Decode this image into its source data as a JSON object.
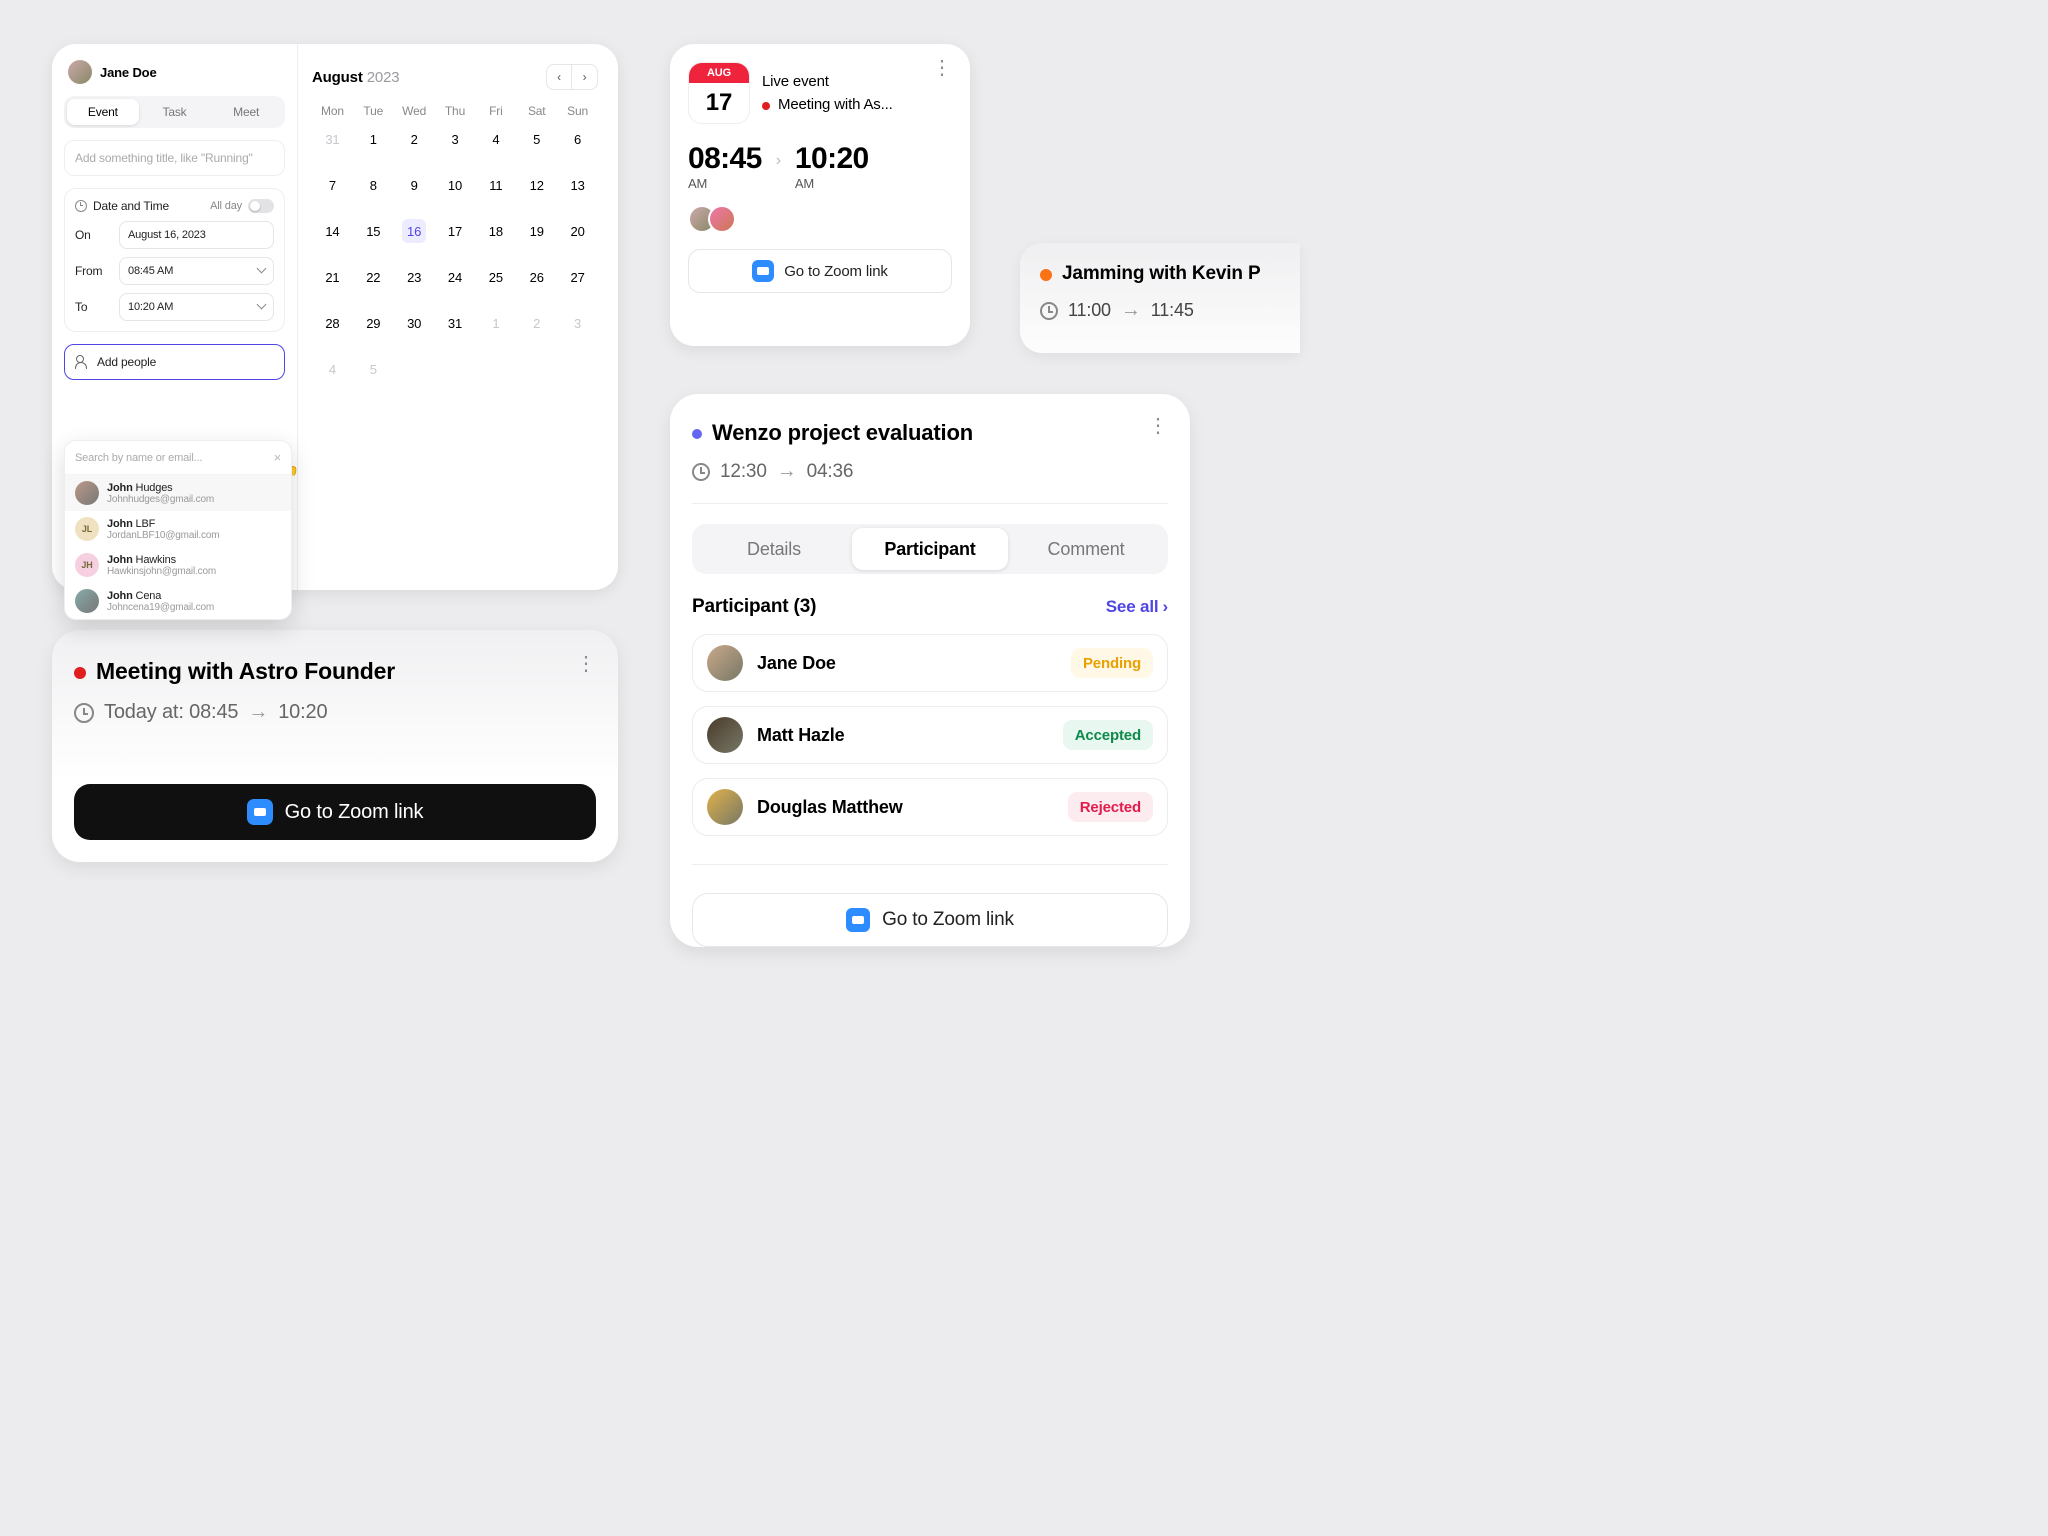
{
  "create": {
    "user_name": "Jane Doe",
    "tabs": {
      "event": "Event",
      "task": "Task",
      "meet": "Meet",
      "active": "event"
    },
    "title_placeholder": "Add something title, like \"Running\"",
    "dt": {
      "label": "Date and Time",
      "allday_label": "All day",
      "on_label": "On",
      "on_value": "August 16, 2023",
      "from_label": "From",
      "from_value": "08:45 AM",
      "to_label": "To",
      "to_value": "10:20 AM"
    },
    "add_people_label": "Add people",
    "people_search_placeholder": "Search by name or email...",
    "people": [
      {
        "first": "John",
        "last": "Hudges",
        "email": "Johnhudges@gmail.com",
        "color": "#b98"
      },
      {
        "first": "John",
        "last": "LBF",
        "email": "JordanLBF10@gmail.com",
        "initials": "JL",
        "color": "#f0e1c0"
      },
      {
        "first": "John",
        "last": "Hawkins",
        "email": "Hawkinsjohn@gmail.com",
        "initials": "JH",
        "color": "#f6cfe0"
      },
      {
        "first": "John",
        "last": "Cena",
        "email": "Johncena19@gmail.com",
        "color": "#8aa"
      }
    ]
  },
  "calendar": {
    "month": "August",
    "year": "2023",
    "dow": [
      "Mon",
      "Tue",
      "Wed",
      "Thu",
      "Fri",
      "Sat",
      "Sun"
    ],
    "selected": 16,
    "cells": [
      {
        "n": 31,
        "dim": true
      },
      {
        "n": 1
      },
      {
        "n": 2
      },
      {
        "n": 3
      },
      {
        "n": 4
      },
      {
        "n": 5
      },
      {
        "n": 6
      },
      {
        "n": 7
      },
      {
        "n": 8
      },
      {
        "n": 9
      },
      {
        "n": 10
      },
      {
        "n": 11
      },
      {
        "n": 12
      },
      {
        "n": 13
      },
      {
        "n": 14
      },
      {
        "n": 15
      },
      {
        "n": 16,
        "sel": true
      },
      {
        "n": 17
      },
      {
        "n": 18
      },
      {
        "n": 19
      },
      {
        "n": 20
      },
      {
        "n": 21
      },
      {
        "n": 22
      },
      {
        "n": 23
      },
      {
        "n": 24
      },
      {
        "n": 25
      },
      {
        "n": 26
      },
      {
        "n": 27
      },
      {
        "n": 28
      },
      {
        "n": 29
      },
      {
        "n": 30
      },
      {
        "n": 31
      },
      {
        "n": 1,
        "dim": true
      },
      {
        "n": 2,
        "dim": true
      },
      {
        "n": 3,
        "dim": true
      },
      {
        "n": 4,
        "dim": true
      },
      {
        "n": 5,
        "dim": true
      }
    ]
  },
  "astro": {
    "title": "Meeting with Astro Founder",
    "time_text": "Today at: 08:45",
    "time_end": "10:20",
    "zoom_label": "Go to Zoom link"
  },
  "live": {
    "month": "AUG",
    "day": "17",
    "label": "Live event",
    "title": "Meeting with As...",
    "start": "08:45",
    "start_ap": "AM",
    "end": "10:20",
    "end_ap": "AM",
    "zoom_label": "Go to Zoom link"
  },
  "jam": {
    "title": "Jamming with Kevin P",
    "start": "11:00",
    "end": "11:45"
  },
  "wenzo": {
    "title": "Wenzo project evaluation",
    "start": "12:30",
    "end": "04:36",
    "tabs": {
      "details": "Details",
      "participant": "Participant",
      "comment": "Comment",
      "active": "participant"
    },
    "participant_header": "Participant (3)",
    "see_all": "See all",
    "participants": [
      {
        "name": "Jane Doe",
        "status": "Pending",
        "status_class": "pending",
        "color": "#caa98a"
      },
      {
        "name": "Matt Hazle",
        "status": "Accepted",
        "status_class": "accepted",
        "color": "#4a3b2b"
      },
      {
        "name": "Douglas Matthew",
        "status": "Rejected",
        "status_class": "rejected",
        "color": "#e0b24a"
      }
    ],
    "zoom_label": "Go to Zoom link"
  }
}
